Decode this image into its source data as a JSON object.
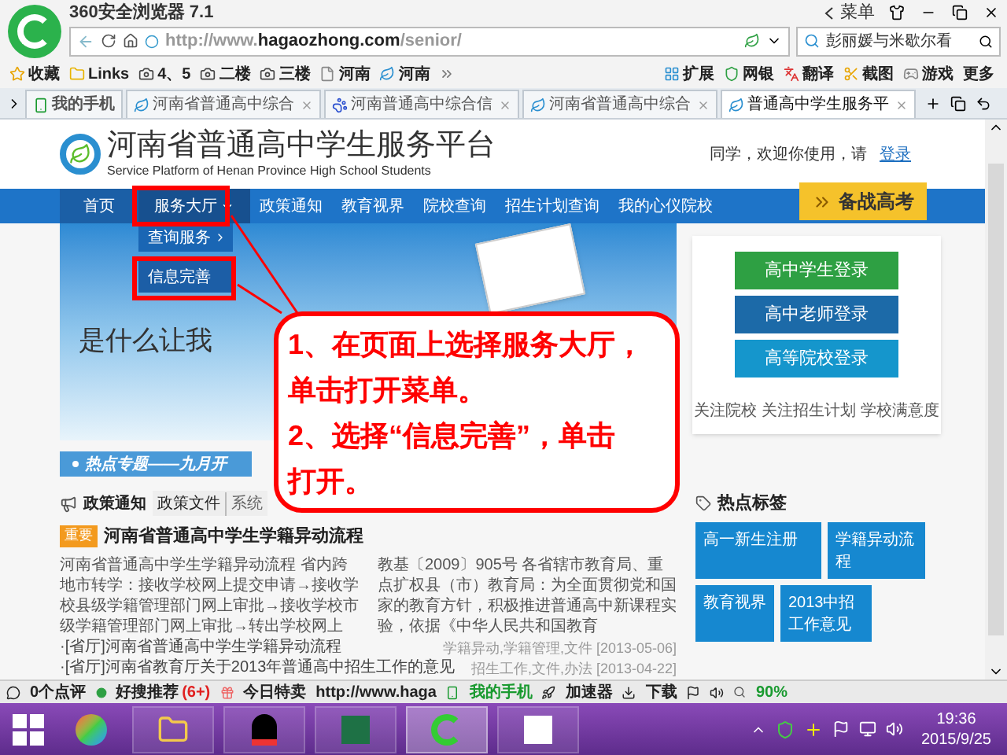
{
  "browser": {
    "title": "360安全浏览器 7.1",
    "menu": "菜单",
    "url": "http://www.**hagaozhong.com**/senior/",
    "search": "彭丽媛与米歇尔看"
  },
  "bookmarks": [
    {
      "label": "收藏",
      "kind": "favorites"
    },
    {
      "label": "Links",
      "kind": "folder"
    },
    {
      "label": "4、5",
      "kind": "camera"
    },
    {
      "label": "二楼",
      "kind": "camera"
    },
    {
      "label": "三楼",
      "kind": "camera"
    },
    {
      "label": "河南",
      "kind": "page"
    },
    {
      "label": "河南",
      "kind": "leaf"
    }
  ],
  "tools": [
    "扩展",
    "网银",
    "翻译",
    "截图",
    "游戏",
    "更多"
  ],
  "tabs": [
    {
      "label": "我的手机",
      "selected": false,
      "kind": "phone"
    },
    {
      "label": "河南省普通高中综合",
      "selected": false,
      "kind": "leaf"
    },
    {
      "label": "河南普通高中综合信",
      "selected": false,
      "kind": "paw"
    },
    {
      "label": "河南省普通高中综合",
      "selected": false,
      "kind": "leaf"
    },
    {
      "label": "普通高中学生服务平",
      "selected": true,
      "kind": "leaf"
    }
  ],
  "site": {
    "title": "河南省普通高中学生服务平台",
    "subtitle": "Service Platform of Henan Province High School Students",
    "greeting": "同学，欢迎你使用，请",
    "login": "登录",
    "nav": [
      {
        "label": "首页",
        "selected": false,
        "dropdown": false
      },
      {
        "label": "服务大厅",
        "selected": true,
        "dropdown": true
      },
      {
        "label": "政策通知",
        "selected": false,
        "dropdown": false
      },
      {
        "label": "教育视界",
        "selected": false,
        "dropdown": false
      },
      {
        "label": "院校查询",
        "selected": false,
        "dropdown": false
      },
      {
        "label": "招生计划查询",
        "selected": false,
        "dropdown": false
      },
      {
        "label": "我的心仪院校",
        "selected": false,
        "dropdown": false
      }
    ],
    "exam_button": "备战高考",
    "menu": [
      {
        "label": "查询服务",
        "submenu": true
      },
      {
        "label": "信息完善",
        "submenu": false
      }
    ],
    "banner": {
      "headline": "是什么让我"
    },
    "logins": [
      {
        "label": "高中学生登录",
        "color": "#2ea043"
      },
      {
        "label": "高中老师登录",
        "color": "#1c6aa8"
      },
      {
        "label": "高等院校登录",
        "color": "#1596cc"
      }
    ],
    "follow_links": [
      "关注院校",
      "关注招生计划",
      "学校满意度"
    ],
    "hot_topic": "热点专题——九月开",
    "policy": {
      "title": "政策通知",
      "tabs": [
        {
          "label": "政策文件",
          "selected": true
        },
        {
          "label": "系统",
          "selected": false
        }
      ],
      "badge": "重要",
      "headline": "河南省普通高中学生学籍异动流程",
      "summary_left": "河南省普通高中学生学籍异动流程 省内跨地市转学：接收学校网上提交申请→接收学校县级学籍管理部门网上审批→接收学校市级学籍管理部门网上审批→转出学校网上",
      "summary_right": "教基〔2009〕905号 各省辖市教育局、重点扩权县（市）教育局：为全面贯彻党和国家的教育方针，积极推进普通高中新课程实验，依据《中华人民共和国教育",
      "items": [
        {
          "title": "·[省厅]河南省普通高中学生学籍异动流程",
          "tags": "学籍异动,学籍管理,文件 [2013-05-06]"
        },
        {
          "title": "·[省厅]河南省教育厅关于2013年普通高中招生工作的意见",
          "tags": "招生工作,文件,办法 [2013-04-22]"
        }
      ]
    },
    "hot_tags": {
      "title": "热点标签",
      "tags": [
        "高一新生注册",
        "学籍异动流程",
        "教育视界",
        "2013中招工作意见"
      ]
    }
  },
  "callout": [
    "1、在页面上选择服务大厅，",
    "单击打开菜单。",
    "2、选择“信息完善”，单击",
    "打开。"
  ],
  "status_bar": {
    "reviews": "0个点评",
    "recommend": "好搜推荐",
    "recommend_count": "(6+)",
    "sale": "今日特卖",
    "url": "http://www.haga",
    "phone": "我的手机",
    "accelerator": "加速器",
    "download": "下载",
    "zoom": "90%"
  },
  "taskbar": {
    "time": "19:36",
    "date": "2015/9/25"
  }
}
